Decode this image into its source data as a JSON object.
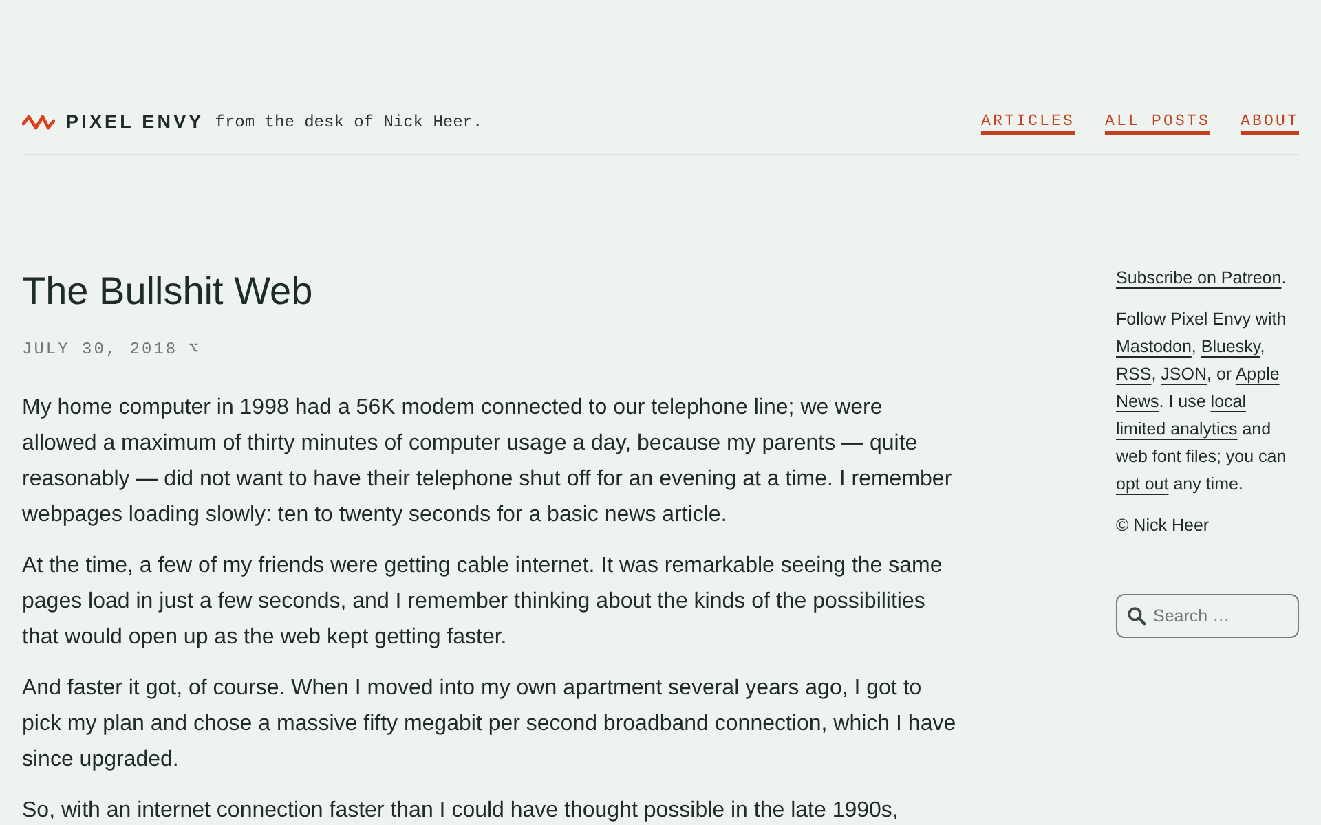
{
  "header": {
    "logo_text": "PIXEL ENVY",
    "tagline": "from the desk of Nick Heer.",
    "nav": [
      {
        "label": "ARTICLES"
      },
      {
        "label": "ALL POSTS"
      },
      {
        "label": "ABOUT"
      }
    ]
  },
  "article": {
    "title": "The Bullshit Web",
    "date": "JULY 30, 2018",
    "permalink": "⌥",
    "paragraphs": [
      {
        "lines": [
          "My home computer in 1998 had a 56K modem connected to our telephone line; we were",
          "allowed a maximum of thirty minutes of computer usage a day, because my parents — quite",
          "reasonably — did not want to have their telephone shut off for an evening at a time. I remember",
          "webpages loading slowly: ten to twenty seconds for a basic news article."
        ]
      },
      {
        "lines": [
          "At the time, a few of my friends were getting cable internet. It was remarkable seeing the same",
          "pages load in just a few seconds, and I remember thinking about the kinds of the possibilities",
          "that would open up as the web kept getting faster."
        ]
      },
      {
        "lines": [
          "And faster it got, of course. When I moved into my own apartment several years ago, I got to",
          "pick my plan and chose a massive fifty megabit per second broadband connection, which I have",
          "since upgraded."
        ]
      },
      {
        "lines": [
          "So, with an internet connection faster than I could have thought possible in the late 1990s,"
        ]
      }
    ]
  },
  "sidebar": {
    "blocks": [
      {
        "lines": [
          [
            {
              "kind": "link",
              "text": "Subscribe on Patreon"
            },
            {
              "kind": "text",
              "text": "."
            }
          ]
        ]
      },
      {
        "lines": [
          [
            {
              "kind": "text",
              "text": "Follow Pixel Envy with"
            }
          ],
          [
            {
              "kind": "link",
              "text": "Mastodon"
            },
            {
              "kind": "text",
              "text": ", "
            },
            {
              "kind": "link",
              "text": "Bluesky"
            },
            {
              "kind": "text",
              "text": ","
            }
          ],
          [
            {
              "kind": "link",
              "text": "RSS"
            },
            {
              "kind": "text",
              "text": ", "
            },
            {
              "kind": "link",
              "text": "JSON"
            },
            {
              "kind": "text",
              "text": ", or "
            },
            {
              "kind": "link",
              "text": "Apple"
            }
          ],
          [
            {
              "kind": "link",
              "text": "News"
            },
            {
              "kind": "text",
              "text": ". I use "
            },
            {
              "kind": "link",
              "text": "local"
            }
          ],
          [
            {
              "kind": "link",
              "text": "limited analytics"
            },
            {
              "kind": "text",
              "text": " and"
            }
          ],
          [
            {
              "kind": "text",
              "text": "web font files; you can"
            }
          ],
          [
            {
              "kind": "link",
              "text": "opt out"
            },
            {
              "kind": "text",
              "text": " any time."
            }
          ]
        ]
      },
      {
        "lines": [
          [
            {
              "kind": "text",
              "text": "© Nick Heer"
            }
          ]
        ]
      }
    ],
    "search": {
      "placeholder": "Search …"
    }
  }
}
